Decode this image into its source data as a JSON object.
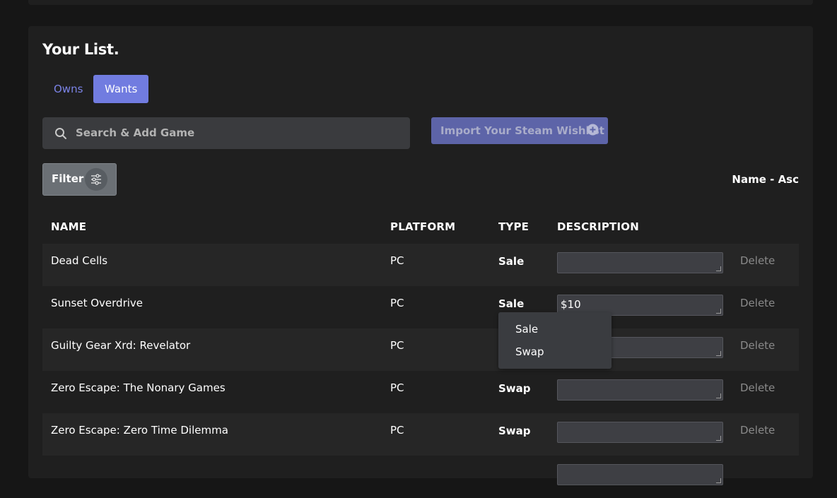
{
  "page": {
    "title": "Your List.",
    "tabs": [
      {
        "label": "Owns",
        "active": false
      },
      {
        "label": "Wants",
        "active": true
      }
    ],
    "search": {
      "placeholder": "Search & Add Game"
    },
    "import_button": {
      "label": "Import Your Steam Wishlist",
      "icon": "plus-circle-icon"
    },
    "filter_button": {
      "label": "Filter",
      "icon": "sliders-icon"
    },
    "sort_label": "Name - Asc"
  },
  "table": {
    "headers": {
      "name": "NAME",
      "platform": "PLATFORM",
      "type": "TYPE",
      "description": "DESCRIPTION"
    },
    "rows": [
      {
        "name": "Dead Cells",
        "platform": "PC",
        "type": "Sale",
        "description": "",
        "action": "Delete"
      },
      {
        "name": "Sunset Overdrive",
        "platform": "PC",
        "type": "Sale",
        "description": "$10",
        "action": "Delete"
      },
      {
        "name": "Guilty Gear Xrd: Revelator",
        "platform": "PC",
        "type": "",
        "description": "",
        "action": "Delete"
      },
      {
        "name": "Zero Escape: The Nonary Games",
        "platform": "PC",
        "type": "Swap",
        "description": "",
        "action": "Delete"
      },
      {
        "name": "Zero Escape: Zero Time Dilemma",
        "platform": "PC",
        "type": "Swap",
        "description": "",
        "action": "Delete"
      }
    ]
  },
  "type_dropdown": {
    "options": [
      "Sale",
      "Swap"
    ]
  },
  "colors": {
    "accent": "#717ce0",
    "background": "#161616",
    "card": "#1f1f1f",
    "row_alt": "#262626",
    "input": "#3e3f44"
  }
}
